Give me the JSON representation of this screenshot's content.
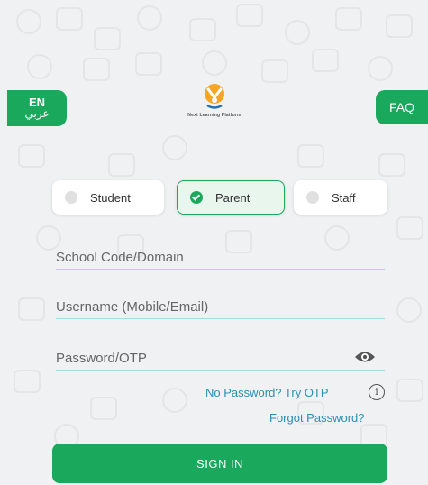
{
  "lang_toggle": {
    "primary": "EN",
    "secondary": "عربي"
  },
  "faq": {
    "label": "FAQ"
  },
  "logo": {
    "text": "Next Learning Platform"
  },
  "roles": [
    {
      "label": "Student",
      "selected": false
    },
    {
      "label": "Parent",
      "selected": true
    },
    {
      "label": "Staff",
      "selected": false
    }
  ],
  "form": {
    "school_code_placeholder": "School Code/Domain",
    "username_placeholder": "Username (Mobile/Email)",
    "password_placeholder": "Password/OTP"
  },
  "links": {
    "otp": "No Password? Try OTP",
    "forgot": "Forgot Password?"
  },
  "sign_in": {
    "label": "SIGN IN"
  },
  "icons": {
    "eye": "eye-icon",
    "info": "info-icon",
    "check": "check-icon",
    "logo": "logo-icon"
  },
  "colors": {
    "accent": "#1aa85c",
    "link": "#2d8fb0",
    "field_underline": "#a8d8e3",
    "background": "#f0f1f2"
  }
}
